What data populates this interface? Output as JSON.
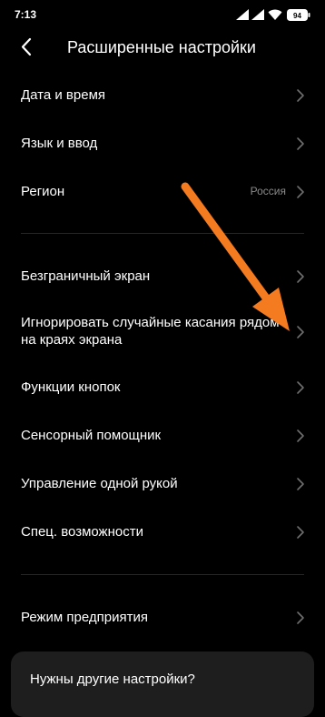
{
  "status_bar": {
    "time": "7:13",
    "battery_level": "94",
    "icons": [
      "signal-icon",
      "signal-icon",
      "wifi-icon",
      "battery-icon"
    ]
  },
  "header": {
    "back_icon": "back-arrow-icon",
    "title": "Расширенные настройки"
  },
  "settings": {
    "group1": [
      {
        "label": "Дата и время"
      },
      {
        "label": "Язык и ввод"
      },
      {
        "label": "Регион",
        "value": "Россия"
      }
    ],
    "group2": [
      {
        "label": "Безграничный экран"
      },
      {
        "label": "Игнорировать случайные касания рядом на краях экрана"
      },
      {
        "label": "Функции кнопок"
      },
      {
        "label": "Сенсорный помощник"
      },
      {
        "label": "Управление одной рукой"
      },
      {
        "label": "Спец. возможности"
      }
    ],
    "group3": [
      {
        "label": "Режим предприятия"
      }
    ]
  },
  "more_card": {
    "label": "Нужны другие настройки?"
  },
  "colors": {
    "background": "#000000",
    "text": "#ffffff",
    "secondary_text": "#8a8a8a",
    "chevron": "#6e6e6e",
    "card": "#1e1e1e",
    "annotation_arrow": "#f47b20"
  }
}
